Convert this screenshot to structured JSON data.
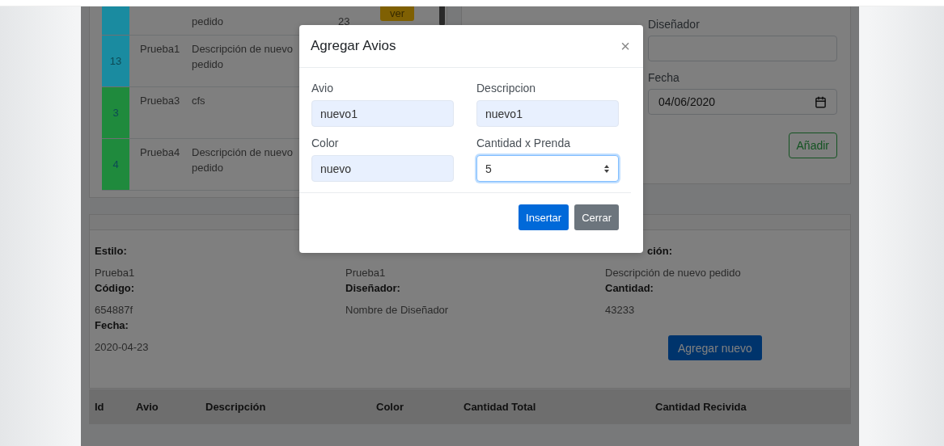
{
  "orders_table": {
    "rows": [
      {
        "color": "#1a8ba0",
        "description": "pedido",
        "quantity": "23",
        "action": "ver"
      },
      {
        "color": "#1a8ba0",
        "id": "13",
        "name": "Prueba1",
        "description": "Descripción de nuevo pedido"
      },
      {
        "color": "#1f8a3d",
        "id": "3",
        "name": "Prueba3",
        "description": "cfs"
      },
      {
        "color": "#1f8a3d",
        "id": "4",
        "name": "Prueba4",
        "description": "Descripción de nuevo pedido"
      }
    ]
  },
  "order_form": {
    "fields": [
      {
        "label": "Diseñador",
        "kind": "text"
      },
      {
        "label": "Fecha",
        "kind": "date",
        "value": "04/06/2020"
      }
    ],
    "add_button": "Añadir"
  },
  "order_details": {
    "items": [
      {
        "label": "Estilo:",
        "value": "Prueba1"
      },
      {
        "value": "Prueba1"
      },
      {
        "label": "ción:",
        "value": "Descripción de nuevo pedido",
        "covered": true
      },
      {
        "label": "Código:",
        "value": "654887f"
      },
      {
        "label": "Diseñador:",
        "value": "Nombre de Diseñador"
      },
      {
        "label": "Cantidad:",
        "value": "43233"
      },
      {
        "label": "Fecha:",
        "value": "2020-04-23"
      }
    ],
    "add_button": "Agregar nuevo"
  },
  "trims_table": {
    "columns": [
      "Id",
      "Avio",
      "Descripción",
      "Color",
      "Cantidad Total",
      "Cantidad Recivida"
    ]
  },
  "modal": {
    "title": "Agregar Avios",
    "close": "×",
    "fields": [
      {
        "label": "Avio",
        "value": "nuevo1",
        "kind": "text",
        "focused": false
      },
      {
        "label": "Descripcion",
        "value": "nuevo1",
        "kind": "text",
        "focused": false
      },
      {
        "label": "Color",
        "value": "nuevo",
        "kind": "text",
        "focused": false
      },
      {
        "label": "Cantidad x Prenda",
        "value": "5",
        "kind": "number",
        "focused": true
      }
    ],
    "buttons": [
      {
        "label": "Insertar",
        "kind": "primary"
      },
      {
        "label": "Cerrar",
        "kind": "secondary"
      }
    ]
  }
}
